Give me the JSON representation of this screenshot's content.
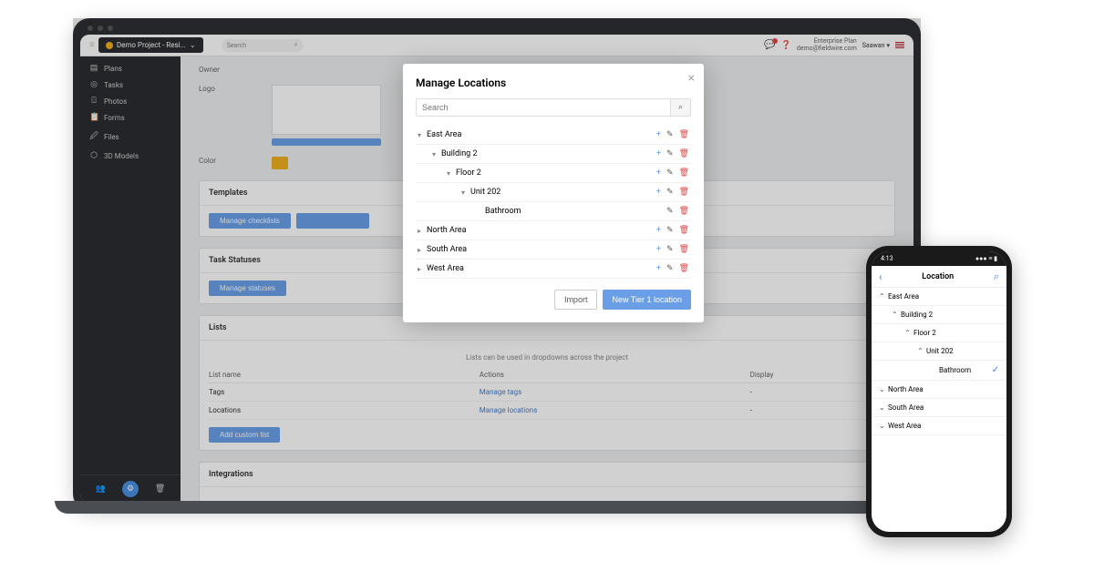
{
  "topbar": {
    "project_name": "Demo Project - Resi...",
    "search_placeholder": "Search",
    "plan_line1": "Enterprise Plan",
    "plan_line2": "demo@fieldwire.com",
    "user_name": "Saawan"
  },
  "sidebar": {
    "items": [
      {
        "icon": "▤",
        "label": "Plans"
      },
      {
        "icon": "◎",
        "label": "Tasks"
      },
      {
        "icon": "⌼",
        "label": "Photos"
      },
      {
        "icon": "📋",
        "label": "Forms"
      },
      {
        "icon": "🖉",
        "label": "Files"
      },
      {
        "icon": "⬡",
        "label": "3D Models"
      }
    ],
    "footer": [
      "👥",
      "⚙",
      "🗑"
    ]
  },
  "settings": {
    "owner_label": "Owner",
    "logo_label": "Logo",
    "color_label": "Color",
    "templates": {
      "title": "Templates",
      "btn_checklists": "Manage checklists"
    },
    "statuses": {
      "title": "Task Statuses",
      "btn_statuses": "Manage statuses"
    },
    "lists": {
      "title": "Lists",
      "hint": "Lists can be used in dropdowns across the project",
      "col_name": "List name",
      "col_actions": "Actions",
      "col_display": "Display",
      "rows": [
        {
          "name": "Tags",
          "action": "Manage tags",
          "display": "-"
        },
        {
          "name": "Locations",
          "action": "Manage locations",
          "display": "-"
        }
      ],
      "btn_add": "Add custom list"
    },
    "integrations": {
      "title": "Integrations"
    }
  },
  "modal": {
    "title": "Manage Locations",
    "search_placeholder": "Search",
    "tree": [
      {
        "indent": 0,
        "caret": "▾",
        "name": "East Area",
        "add": true,
        "edit": true,
        "del": true
      },
      {
        "indent": 1,
        "caret": "▾",
        "name": "Building 2",
        "add": true,
        "edit": true,
        "del": true
      },
      {
        "indent": 2,
        "caret": "▾",
        "name": "Floor 2",
        "add": true,
        "edit": true,
        "del": true
      },
      {
        "indent": 3,
        "caret": "▾",
        "name": "Unit 202",
        "add": true,
        "edit": true,
        "del": true
      },
      {
        "indent": 4,
        "caret": "",
        "name": "Bathroom",
        "add": false,
        "edit": true,
        "del": true
      },
      {
        "indent": 0,
        "caret": "▸",
        "name": "North Area",
        "add": true,
        "edit": true,
        "del": true
      },
      {
        "indent": 0,
        "caret": "▸",
        "name": "South Area",
        "add": true,
        "edit": true,
        "del": true
      },
      {
        "indent": 0,
        "caret": "▸",
        "name": "West Area",
        "add": true,
        "edit": true,
        "del": true
      }
    ],
    "btn_import": "Import",
    "btn_new": "New Tier 1 location"
  },
  "phone": {
    "time": "4:13",
    "title": "Location",
    "tree": [
      {
        "indent": 0,
        "caret": "⌃",
        "name": "East Area",
        "selected": false
      },
      {
        "indent": 1,
        "caret": "⌃",
        "name": "Building 2",
        "selected": false
      },
      {
        "indent": 2,
        "caret": "⌃",
        "name": "Floor 2",
        "selected": false
      },
      {
        "indent": 3,
        "caret": "⌃",
        "name": "Unit 202",
        "selected": false
      },
      {
        "indent": 4,
        "caret": "",
        "name": "Bathroom",
        "selected": true
      },
      {
        "indent": 0,
        "caret": "⌄",
        "name": "North Area",
        "selected": false
      },
      {
        "indent": 0,
        "caret": "⌄",
        "name": "South Area",
        "selected": false
      },
      {
        "indent": 0,
        "caret": "⌄",
        "name": "West Area",
        "selected": false
      }
    ]
  }
}
